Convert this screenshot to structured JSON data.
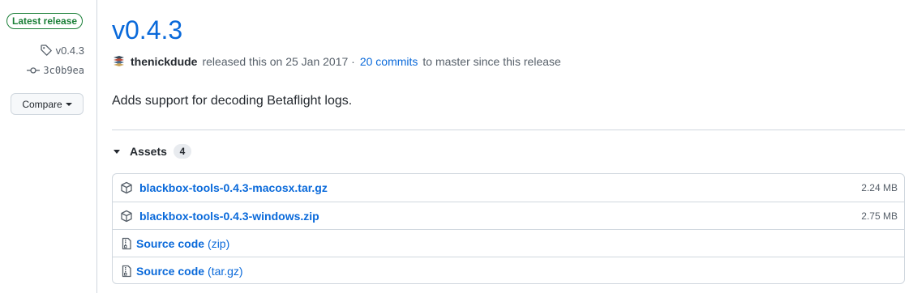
{
  "sidebar": {
    "latest_badge": "Latest release",
    "tag": "v0.4.3",
    "commit": "3c0b9ea",
    "compare_label": "Compare"
  },
  "release": {
    "title": "v0.4.3",
    "author": "thenickdude",
    "released_text": "released this on 25 Jan 2017 ·",
    "commits_link": "20 commits",
    "since_text": "to master since this release",
    "description": "Adds support for decoding Betaflight logs."
  },
  "assets": {
    "label": "Assets",
    "count": "4",
    "items": [
      {
        "name": "blackbox-tools-0.4.3-macosx.tar.gz",
        "size": "2.24 MB",
        "icon": "package-icon"
      },
      {
        "name": "blackbox-tools-0.4.3-windows.zip",
        "size": "2.75 MB",
        "icon": "package-icon"
      },
      {
        "name": "Source code",
        "suffix": "(zip)",
        "icon": "file-zip-icon"
      },
      {
        "name": "Source code",
        "suffix": "(tar.gz)",
        "icon": "file-zip-icon"
      }
    ]
  },
  "colors": {
    "accent": "#0969da",
    "success": "#1a7f37",
    "border": "#d0d7de",
    "muted": "#57606a"
  }
}
